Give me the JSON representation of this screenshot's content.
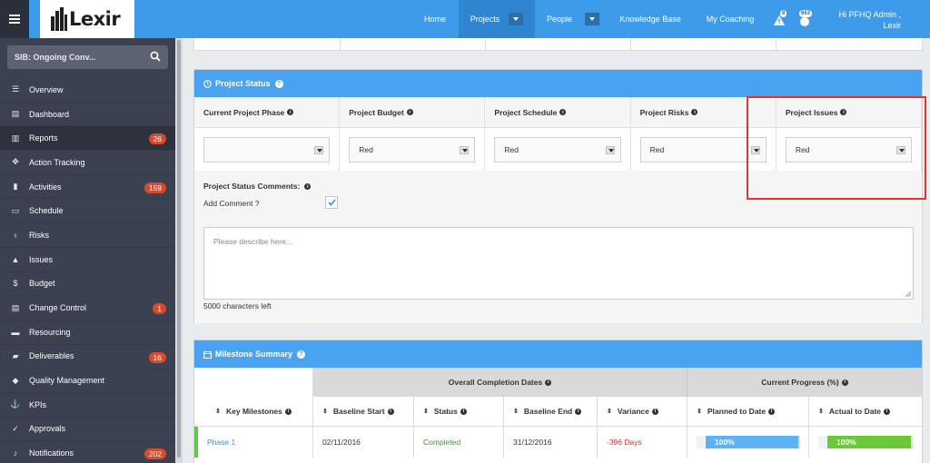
{
  "header": {
    "logo_text": "Lexir",
    "nav": [
      {
        "label": "Home"
      },
      {
        "label": "Projects"
      },
      {
        "label": "People"
      },
      {
        "label": "Knowledge Base"
      },
      {
        "label": "My Coaching"
      }
    ],
    "alerts_count": "8",
    "messages_count": "663",
    "user_greeting_line1": "Hi PFHQ Admin ,",
    "user_greeting_line2": "Lexir"
  },
  "sidebar": {
    "search_text": "SIB: Ongoing Conv...",
    "items": [
      {
        "label": "Overview",
        "icon": "list-icon",
        "count": ""
      },
      {
        "label": "Dashboard",
        "icon": "dashboard-icon",
        "count": ""
      },
      {
        "label": "Reports",
        "icon": "bar-chart-icon",
        "count": "26"
      },
      {
        "label": "Action Tracking",
        "icon": "crosshair-icon",
        "count": ""
      },
      {
        "label": "Activities",
        "icon": "bookmark-icon",
        "count": "159"
      },
      {
        "label": "Schedule",
        "icon": "calendar-icon",
        "count": ""
      },
      {
        "label": "Risks",
        "icon": "lightbulb-icon",
        "count": ""
      },
      {
        "label": "Issues",
        "icon": "warning-icon",
        "count": ""
      },
      {
        "label": "Budget",
        "icon": "dollar-icon",
        "count": ""
      },
      {
        "label": "Change Control",
        "icon": "document-icon",
        "count": "1"
      },
      {
        "label": "Resourcing",
        "icon": "folder-icon",
        "count": ""
      },
      {
        "label": "Deliverables",
        "icon": "truck-icon",
        "count": "16"
      },
      {
        "label": "Quality Management",
        "icon": "tag-icon",
        "count": ""
      },
      {
        "label": "KPIs",
        "icon": "anchor-icon",
        "count": ""
      },
      {
        "label": "Approvals",
        "icon": "thumbs-up-icon",
        "count": ""
      },
      {
        "label": "Notifications",
        "icon": "bell-icon",
        "count": "202"
      }
    ]
  },
  "project_status": {
    "title": "Project Status",
    "columns": [
      {
        "label": "Current Project Phase",
        "value": ""
      },
      {
        "label": "Project Budget",
        "value": "Red"
      },
      {
        "label": "Project Schedule",
        "value": "Red"
      },
      {
        "label": "Project Risks",
        "value": "Red"
      },
      {
        "label": "Project Issues",
        "value": "Red"
      }
    ],
    "comments_label": "Project Status Comments:",
    "add_comment_label": "Add Comment ?",
    "placeholder": "Please describe here...",
    "chars_left": "5000 characters left"
  },
  "milestones": {
    "title": "Milestone Summary",
    "group_headers": [
      "Overall Completion Dates",
      "Current Progress (%)"
    ],
    "columns": [
      "Key Milestones",
      "Baseline Start",
      "Status",
      "Baseline End",
      "Variance",
      "Planned to Date",
      "Actual to Date"
    ],
    "rows": [
      {
        "name": "Phase 1",
        "baseline_start": "02/11/2016",
        "status": "Completed",
        "baseline_end": "31/12/2016",
        "variance": "-396 Days",
        "planned": "100%",
        "actual": "100%",
        "planned_fraction": 1.0,
        "actual_fraction": 1.0
      }
    ]
  },
  "colors": {
    "accent_blue": "#4aa3f0",
    "sidebar_bg": "#3b4150",
    "badge_red": "#d64b2a",
    "status_green": "#63c94e",
    "variance_red": "#d0342c",
    "highlight_red": "#e2352b"
  }
}
